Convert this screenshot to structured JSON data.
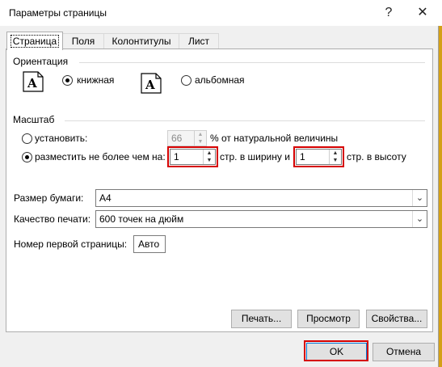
{
  "window": {
    "title": "Параметры страницы",
    "help_icon": "?",
    "close_icon": "✕"
  },
  "tabs": [
    {
      "label": "Страница",
      "active": true
    },
    {
      "label": "Поля"
    },
    {
      "label": "Колонтитулы"
    },
    {
      "label": "Лист"
    }
  ],
  "orientation": {
    "group_label": "Ориентация",
    "portrait": {
      "label": "книжная",
      "selected": true
    },
    "landscape": {
      "label": "альбомная",
      "selected": false
    }
  },
  "scaling": {
    "group_label": "Масштаб",
    "adjust": {
      "label": "установить:",
      "value": "66",
      "suffix": "% от натуральной величины",
      "selected": false
    },
    "fit": {
      "label": "разместить не более чем на:",
      "selected": true,
      "wide_value": "1",
      "wide_suffix": "стр. в ширину и",
      "tall_value": "1",
      "tall_suffix": "стр. в высоту"
    }
  },
  "paper_size": {
    "label": "Размер бумаги:",
    "value": "А4"
  },
  "print_quality": {
    "label": "Качество печати:",
    "value": "600 точек на дюйм"
  },
  "first_page": {
    "label": "Номер первой страницы:",
    "value": "Авто"
  },
  "buttons": {
    "print": "Печать...",
    "preview": "Просмотр",
    "properties": "Свойства...",
    "ok": "OK",
    "cancel": "Отмена"
  },
  "highlight_color": "#d50000"
}
